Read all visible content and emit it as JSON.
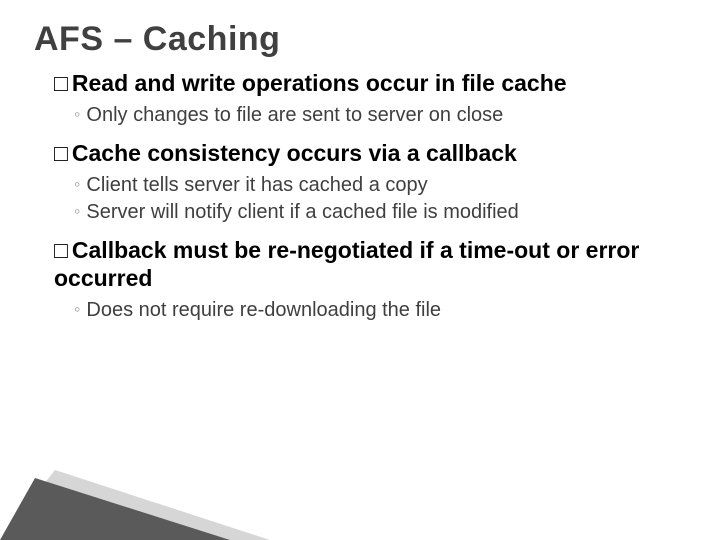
{
  "title": "AFS – Caching",
  "items": [
    {
      "text": "Read and write operations occur in file cache",
      "subs": [
        "Only changes to file are sent to server on close"
      ]
    },
    {
      "text": "Cache consistency occurs via a callback",
      "subs": [
        "Client tells server it has cached a copy",
        "Server will notify client if a cached file is modified"
      ]
    },
    {
      "text": "Callback must be re-negotiated if a time-out or error occurred",
      "subs": [
        "Does not require re-downloading the file"
      ]
    }
  ]
}
